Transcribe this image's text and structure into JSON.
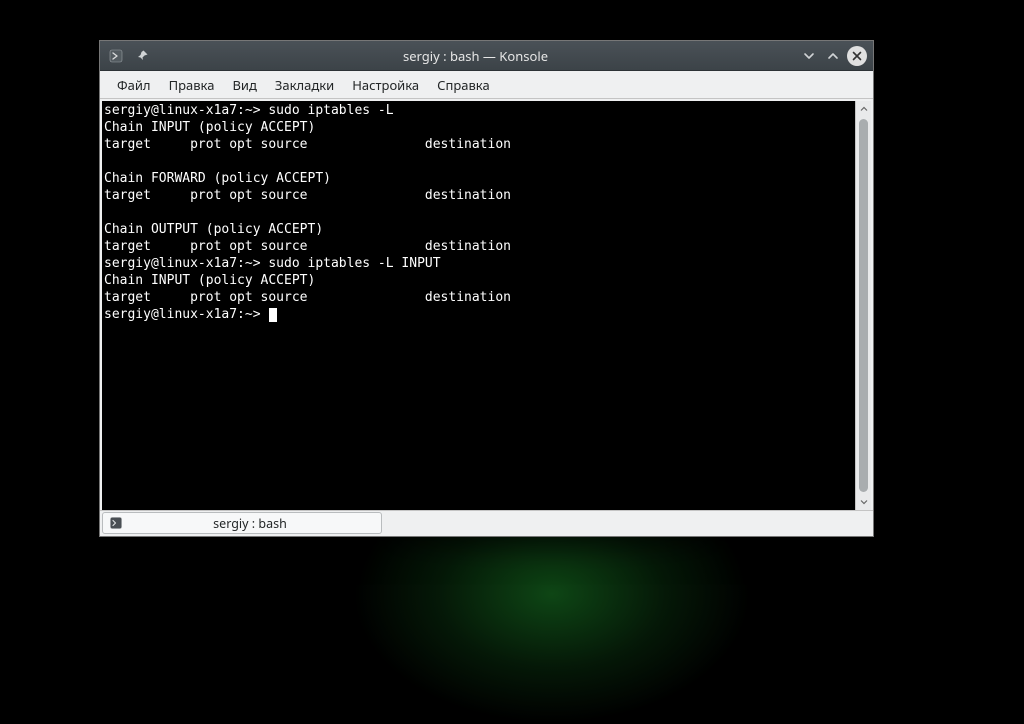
{
  "window": {
    "title": "sergiy : bash — Konsole"
  },
  "menubar": {
    "items": [
      {
        "label": "Файл"
      },
      {
        "label": "Правка"
      },
      {
        "label": "Вид"
      },
      {
        "label": "Закладки"
      },
      {
        "label": "Настройка"
      },
      {
        "label": "Справка"
      }
    ]
  },
  "terminal": {
    "lines": [
      "sergiy@linux-x1a7:~> sudo iptables -L",
      "Chain INPUT (policy ACCEPT)",
      "target     prot opt source               destination",
      "",
      "Chain FORWARD (policy ACCEPT)",
      "target     prot opt source               destination",
      "",
      "Chain OUTPUT (policy ACCEPT)",
      "target     prot opt source               destination",
      "sergiy@linux-x1a7:~> sudo iptables -L INPUT",
      "Chain INPUT (policy ACCEPT)",
      "target     prot opt source               destination",
      "sergiy@linux-x1a7:~> "
    ]
  },
  "tab": {
    "label": "sergiy : bash"
  }
}
